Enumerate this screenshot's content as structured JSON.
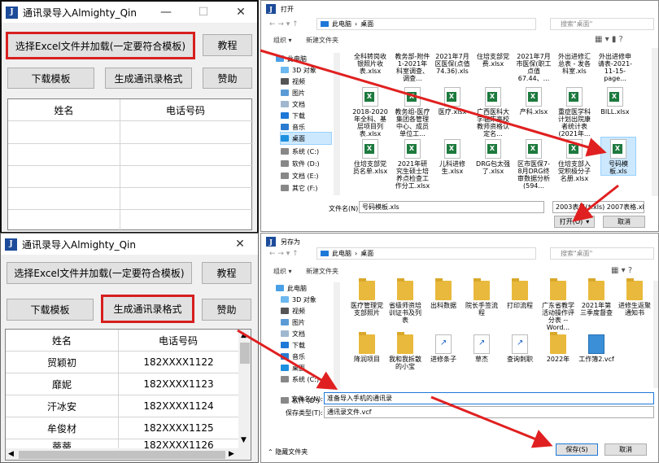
{
  "app_top": {
    "title": "通讯录导入Almighty_Qin",
    "logo": "J",
    "btn_select": "选择Excel文件并加载(一定要符合模板)",
    "btn_tutorial": "教程",
    "btn_template": "下载模板",
    "btn_generate": "生成通讯录格式",
    "btn_donate": "赞助",
    "col_name": "姓名",
    "col_phone": "电话号码",
    "minimize": "—",
    "maximize": "☐",
    "close": "✕"
  },
  "app_bottom": {
    "title": "通讯录导入Almighty_Qin",
    "logo": "J",
    "btn_select": "选择Excel文件并加载(一定要符合模板)",
    "btn_tutorial": "教程",
    "btn_template": "下载模板",
    "btn_generate": "生成通讯录格式",
    "btn_donate": "赞助",
    "col_name": "姓名",
    "col_phone": "电话号码",
    "close": "✕",
    "rows": [
      {
        "name": "贸颖初",
        "phone": "182XXXX1122"
      },
      {
        "name": "靡妮",
        "phone": "182XXXX1123"
      },
      {
        "name": "汗冰安",
        "phone": "182XXXX1124"
      },
      {
        "name": "牟俊材",
        "phone": "182XXXX1125"
      },
      {
        "name": "蒂蒂",
        "phone": "182XXXX1126"
      }
    ]
  },
  "open_dlg": {
    "title": "打开",
    "path1": "此电脑",
    "path2": "桌面",
    "search_placeholder": "搜索\"桌面\"",
    "organize": "组织 ▾",
    "new_folder": "新建文件夹",
    "nav": [
      "此电脑",
      "3D 对象",
      "视频",
      "图片",
      "文档",
      "下载",
      "音乐",
      "桌面",
      "系统 (C:)",
      "软件 (D:)",
      "文档 (E:)",
      "其它 (F:)"
    ],
    "top_row": [
      "全科转岗收银照片收表.xlsx",
      "教务部-附件1-2021年科室调查、调查...",
      "2021年7月区医保(点值74.36).xls",
      "住培支部党费.xlsx",
      "2021年7月市医保(职工点值67.44、...",
      "外出进修汇总表 - 发各科室.xls",
      "外出进修申请表-2021-11-15-page..."
    ],
    "row2": [
      "2018-2020年全科、基层项目列表.xlsx",
      "教务组-医疗集团各管理中心、成员单位工...",
      "医疗.xlsx",
      "广西医科大学临床高校教师资格认定名...",
      "产科.xlsx",
      "重症医学科计划出院康者统计表(2021年...",
      "BILL.xlsx"
    ],
    "row3": [
      "住培支部党员名单.xlsx",
      "2021年研究生硕士培养点检查工作分工.xlsx",
      "儿科进修生.xlsx",
      "DRG包太强了.xlsx",
      "区市医保7-8月DRG终审数据分析(594...",
      "住培支部入党积极分子名册.xlsx",
      "号码模板.xls"
    ],
    "filename_label": "文件名(N):",
    "filename": "号码模板.xls",
    "filetype": "2003表格(*.xls) 2007表格.xlsx",
    "open_btn": "打开(O)",
    "cancel_btn": "取消"
  },
  "save_dlg": {
    "title": "另存为",
    "path1": "此电脑",
    "path2": "桌面",
    "search_placeholder": "搜索\"桌面\"",
    "organize": "组织 ▾",
    "new_folder": "新建文件夹",
    "nav": [
      "此电脑",
      "3D 对象",
      "视频",
      "图片",
      "文档",
      "下载",
      "音乐",
      "桌面",
      "系统 (C:)",
      "软件 (D:)"
    ],
    "row1": [
      "医疗管理党支部照片",
      "省级师资培训证书及列表",
      "出科数据",
      "院长手签流程",
      "打印流程",
      "广东省教学活动操作评分表 --Word...",
      "2021年第三季度督查",
      "进修生返聚通知书"
    ],
    "row2": [
      "降润项目",
      "我和我拆散的小宝",
      "进修条子",
      "草杰",
      "查询刺职",
      "2022年",
      "工作簿2.vcf"
    ],
    "filename_label": "文件名(N):",
    "filename": "准备导入手机的通讯录",
    "filetype_label": "保存类型(T):",
    "filetype": "通讯录文件.vcf",
    "hide_folders": "隐藏文件夹",
    "save_btn": "保存(S)",
    "cancel_btn": "取消"
  },
  "colors": {
    "accent_red": "#d71f1f",
    "arrow_red": "#e02020",
    "logo_blue": "#1c4b9a",
    "select_blue": "#cce8ff"
  }
}
